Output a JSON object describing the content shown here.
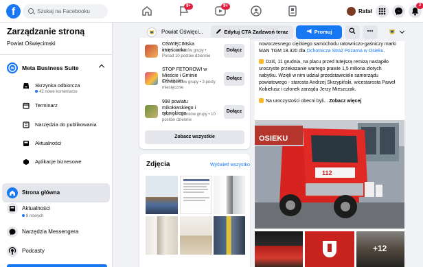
{
  "topbar": {
    "search_placeholder": "Szukaj na Facebooku",
    "badge_flag": "9+",
    "badge_video": "9+",
    "user_name": "Rafał",
    "badge_bell": "2"
  },
  "sidebar": {
    "title": "Zarządzanie stroną",
    "page_name": "Powiat Oświęcimski",
    "meta_suite": "Meta Business Suite",
    "suite_items": [
      {
        "label": "Skrzynka odbiorcza",
        "icon": "inbox-icon"
      },
      {
        "label": "Terminarz",
        "icon": "calendar-icon"
      },
      {
        "label": "Narzędzia do publikowania",
        "icon": "publishing-tools-icon"
      },
      {
        "label": "Aktualności",
        "icon": "news-icon"
      },
      {
        "label": "Aplikacje biznesowe",
        "icon": "apps-icon"
      }
    ],
    "inbox_note": "42 nowe komentarze",
    "main_items": [
      {
        "label": "Strona główna",
        "icon": "home-icon"
      },
      {
        "label": "Aktualności",
        "icon": "news-icon"
      },
      {
        "label": "Narzędzia Messengera",
        "icon": "messenger-icon"
      },
      {
        "label": "Podcasty",
        "icon": "podcast-icon"
      }
    ],
    "news_note": "8 nowych"
  },
  "page_bar": {
    "page_name": "Powiat Oświęci...",
    "edit_cta": "Edytuj CTA Zadzwoń teraz",
    "promote": "Promuj"
  },
  "groups": {
    "items": [
      {
        "title": "OŚWIĘCIMska imieściarka",
        "meta": "13 tys. członków grupy • Ponad 10 postów dziennie",
        "join": "Dołącz"
      },
      {
        "title": "STOP FETOROWI w Mieście i Gminie Oświęcim",
        "meta": "341 członków grupy • 3 posty miesięcznie",
        "join": "Dołącz"
      },
      {
        "title": "998 powiatu mikołowskiego i rybnickiego",
        "meta": "49,9 tys. członków grupy • 10 postów dziennie",
        "join": "Dołącz"
      }
    ],
    "see_all": "Zobacz wszystkie"
  },
  "photos": {
    "title": "Zdjęcia",
    "see_all": "Wyświetl wszystko"
  },
  "post": {
    "line1": "nowoczesnego ciężkiego samochodu ratowniczo-gaśniczy marki MAN TGM 18.320 dla ",
    "link": "Ochotnicza Straż Pożarna w Osieku",
    "line1_end": ".",
    "para2": "Dziś, 11 grudnia, na placu przed tutejszą remizą nastąpiło uroczyste przekazanie wartego prawie 1,5 miliona złotych nabytku. Wzięli w nim udział przedstawiciele samorządu powiatowego - starosta Andrzej Skrzypiński, wicestarosta Paweł Kobielusz i członek zarządu Jerzy Mieszczak.",
    "para3": "Na uroczystości obecni byli...",
    "more": "Zobacz więcej",
    "station_sign": "OSIEKU",
    "truck_number": "112",
    "more_photos": "+12"
  }
}
